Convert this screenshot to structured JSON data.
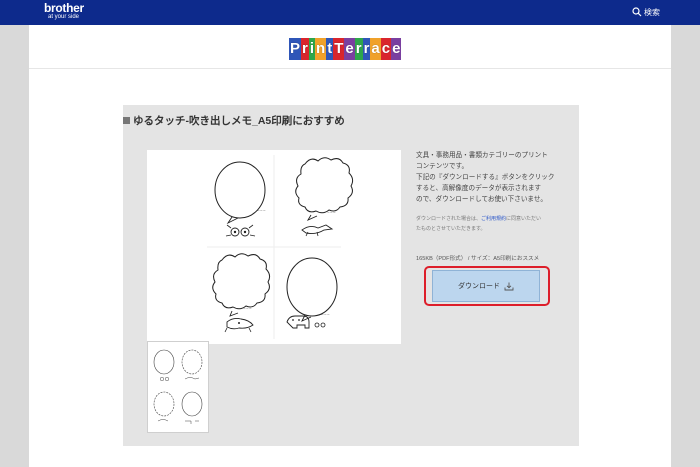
{
  "header": {
    "brand_name": "brother",
    "brand_tagline": "at your side",
    "search_label": "検索"
  },
  "logo": {
    "letters": [
      "P",
      "r",
      "i",
      "n",
      "t",
      "T",
      "e",
      "r",
      "r",
      "a",
      "c",
      "e"
    ],
    "colors": [
      "#2f56b8",
      "#d9252d",
      "#2ea64b",
      "#f0a12a",
      "#2f56b8",
      "#d9252d",
      "#7a3fa0",
      "#2ea64b",
      "#2f56b8",
      "#f0a12a",
      "#d9252d",
      "#7a3fa0"
    ]
  },
  "panel": {
    "title": "ゆるタッチ-吹き出しメモ_A5印刷におすすめ",
    "description": [
      "文具・事務用品・書類カテゴリーのプリント",
      "コンテンツです。",
      "下記の『ダウンロードする』ボタンをクリック",
      "すると、高解像度のデータが表示されます",
      "ので、ダウンロードしてお使い下さいませ。"
    ],
    "note_prefix": "ダウンロードされた場合は、",
    "note_link": "ご利用規約",
    "note_suffix": "に同意いただい",
    "note_line2": "たものとさせていただきます。",
    "file_info": "165KB（PDF形式） / サイズ：A5印刷におススメ",
    "download_label": "ダウンロード"
  },
  "colors": {
    "header_bg": "#0d2a8c",
    "panel_bg": "#e4e4e4",
    "download_bg": "#bcd6ee",
    "highlight": "#dd1e2a"
  }
}
